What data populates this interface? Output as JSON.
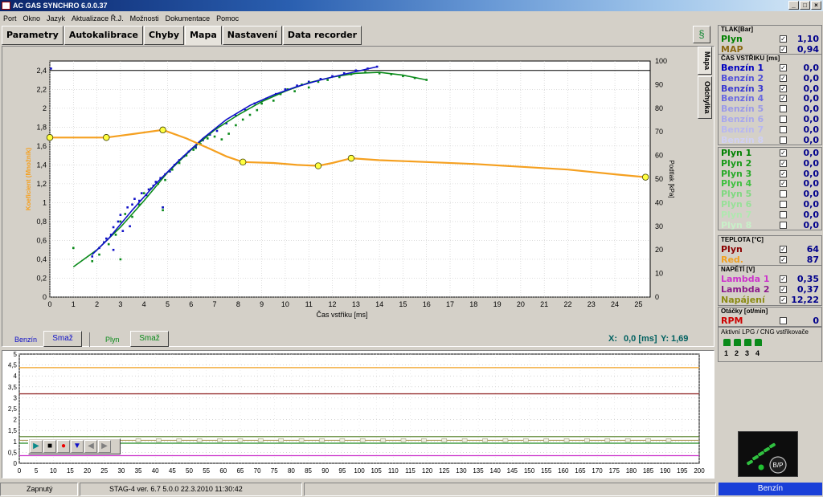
{
  "window": {
    "title": "AC GAS SYNCHRO  6.0.0.37"
  },
  "menu": [
    "Port",
    "Okno",
    "Jazyk",
    "Aktualizace Ř.J.",
    "Možnosti",
    "Dokumentace",
    "Pomoc"
  ],
  "tabs": [
    "Parametry",
    "Autokalibrace",
    "Chyby",
    "Mapa",
    "Nastavení",
    "Data recorder"
  ],
  "active_tab": "Mapa",
  "vertical_tabs": [
    "Mapa",
    "Odchylka"
  ],
  "controls": {
    "benzin_label": "Benzín",
    "benzin_clear": "Smaž",
    "plyn_label": "Plyn",
    "plyn_clear": "Smaž",
    "readout_x_label": "X:",
    "readout_x_value": "0,0 [ms]",
    "readout_y_label": "Y:",
    "readout_y_value": "1,69"
  },
  "chart_data": {
    "type": "scatter",
    "xlabel": "Čas vstřiku [ms]",
    "ylabel_left": "Koeficient (Množník)",
    "ylabel_right": "Podtlak [kPa]",
    "x_ticks": [
      "0",
      "1",
      "2",
      "3",
      "4",
      "5",
      "6",
      "7",
      "8",
      "9",
      "10",
      "11",
      "12",
      "13",
      "14",
      "15",
      "16",
      "17",
      "18",
      "19",
      "20",
      "21",
      "22",
      "23",
      "24",
      "25"
    ],
    "y_left_ticks": [
      "0",
      "0,2",
      "0,4",
      "0,6",
      "0,8",
      "1",
      "1,2",
      "1,4",
      "1,6",
      "1,8",
      "2",
      "2,2",
      "2,4"
    ],
    "y_right_ticks": [
      "0",
      "10",
      "20",
      "30",
      "40",
      "50",
      "60",
      "70",
      "80",
      "90",
      "100"
    ],
    "xlim": [
      0,
      25.5
    ],
    "ylim_left": [
      0,
      2.5
    ],
    "ylim_right": [
      0,
      100
    ],
    "colors": {
      "benzin": "#1010c8",
      "plyn": "#0a8a1a",
      "koef": "#f5a020",
      "koef_marker": "#ffff40"
    },
    "koeficient_points": [
      [
        0,
        1.69
      ],
      [
        2.4,
        1.69
      ],
      [
        4.8,
        1.77
      ],
      [
        8.2,
        1.43
      ],
      [
        11.4,
        1.39
      ],
      [
        12.8,
        1.47
      ],
      [
        25.3,
        1.27
      ]
    ],
    "koeficient_line": [
      [
        0,
        1.69
      ],
      [
        2.4,
        1.69
      ],
      [
        3.6,
        1.73
      ],
      [
        4.8,
        1.77
      ],
      [
        5.8,
        1.68
      ],
      [
        6.8,
        1.57
      ],
      [
        7.5,
        1.49
      ],
      [
        8.2,
        1.43
      ],
      [
        9.5,
        1.42
      ],
      [
        10.5,
        1.4
      ],
      [
        11.4,
        1.39
      ],
      [
        12.0,
        1.42
      ],
      [
        12.8,
        1.47
      ],
      [
        14,
        1.45
      ],
      [
        16,
        1.43
      ],
      [
        18,
        1.41
      ],
      [
        20,
        1.38
      ],
      [
        22,
        1.35
      ],
      [
        24,
        1.3
      ],
      [
        25.3,
        1.27
      ]
    ],
    "benzin_trend": [
      [
        1.8,
        0.45
      ],
      [
        2.5,
        0.62
      ],
      [
        3.5,
        0.92
      ],
      [
        4.5,
        1.2
      ],
      [
        5.5,
        1.45
      ],
      [
        6.5,
        1.68
      ],
      [
        7.5,
        1.88
      ],
      [
        8.5,
        2.03
      ],
      [
        9.5,
        2.14
      ],
      [
        10.5,
        2.23
      ],
      [
        11.5,
        2.3
      ],
      [
        12.5,
        2.36
      ],
      [
        13.9,
        2.44
      ]
    ],
    "plyn_trend": [
      [
        1.0,
        0.32
      ],
      [
        2.0,
        0.5
      ],
      [
        3.0,
        0.74
      ],
      [
        4.0,
        1.02
      ],
      [
        5.0,
        1.32
      ],
      [
        6.0,
        1.56
      ],
      [
        7.0,
        1.77
      ],
      [
        8.0,
        1.93
      ],
      [
        9.0,
        2.07
      ],
      [
        10.0,
        2.18
      ],
      [
        11.0,
        2.27
      ],
      [
        12.0,
        2.33
      ],
      [
        13.0,
        2.37
      ],
      [
        14.0,
        2.38
      ],
      [
        15.0,
        2.35
      ],
      [
        16.0,
        2.3
      ]
    ],
    "benzin_points": [
      [
        0.05,
        2.42
      ],
      [
        1.8,
        0.43
      ],
      [
        2.1,
        0.52
      ],
      [
        2.3,
        0.58
      ],
      [
        2.4,
        0.62
      ],
      [
        2.6,
        0.66
      ],
      [
        2.7,
        0.74
      ],
      [
        2.9,
        0.8
      ],
      [
        3.0,
        0.87
      ],
      [
        3.1,
        0.7
      ],
      [
        3.3,
        0.95
      ],
      [
        3.5,
        0.98
      ],
      [
        3.6,
        1.04
      ],
      [
        3.8,
        1.02
      ],
      [
        3.9,
        1.1
      ],
      [
        4.1,
        1.08
      ],
      [
        4.2,
        1.14
      ],
      [
        4.4,
        1.18
      ],
      [
        4.5,
        1.22
      ],
      [
        4.7,
        1.26
      ],
      [
        4.9,
        1.3
      ],
      [
        5.1,
        1.33
      ],
      [
        5.3,
        1.4
      ],
      [
        5.5,
        1.45
      ],
      [
        5.7,
        1.49
      ],
      [
        5.9,
        1.54
      ],
      [
        6.2,
        1.59
      ],
      [
        6.5,
        1.66
      ],
      [
        6.8,
        1.72
      ],
      [
        7.1,
        1.76
      ],
      [
        7.5,
        1.84
      ],
      [
        7.9,
        1.92
      ],
      [
        8.3,
        1.98
      ],
      [
        8.7,
        2.05
      ],
      [
        9.2,
        2.1
      ],
      [
        9.6,
        2.15
      ],
      [
        10.0,
        2.2
      ],
      [
        10.5,
        2.24
      ],
      [
        11.0,
        2.28
      ],
      [
        11.5,
        2.31
      ],
      [
        12.0,
        2.34
      ],
      [
        12.5,
        2.37
      ],
      [
        13.0,
        2.4
      ],
      [
        13.5,
        2.42
      ],
      [
        13.9,
        2.44
      ],
      [
        2.7,
        0.5
      ],
      [
        3.4,
        0.75
      ],
      [
        4.8,
        0.95
      ]
    ],
    "plyn_points": [
      [
        1.0,
        0.52
      ],
      [
        1.8,
        0.38
      ],
      [
        2.1,
        0.45
      ],
      [
        2.5,
        0.56
      ],
      [
        2.8,
        0.66
      ],
      [
        3.0,
        0.8
      ],
      [
        3.2,
        0.88
      ],
      [
        3.5,
        0.85
      ],
      [
        3.8,
        0.98
      ],
      [
        4.0,
        1.1
      ],
      [
        4.3,
        1.15
      ],
      [
        4.6,
        1.2
      ],
      [
        4.9,
        1.24
      ],
      [
        5.2,
        1.35
      ],
      [
        5.5,
        1.42
      ],
      [
        5.8,
        1.5
      ],
      [
        6.1,
        1.56
      ],
      [
        6.4,
        1.62
      ],
      [
        6.7,
        1.68
      ],
      [
        7.0,
        1.7
      ],
      [
        7.3,
        1.67
      ],
      [
        7.6,
        1.73
      ],
      [
        7.9,
        1.82
      ],
      [
        8.2,
        1.88
      ],
      [
        8.5,
        1.93
      ],
      [
        8.8,
        1.98
      ],
      [
        9.0,
        2.05
      ],
      [
        9.2,
        2.1
      ],
      [
        9.5,
        2.08
      ],
      [
        9.8,
        2.15
      ],
      [
        10.1,
        2.2
      ],
      [
        10.4,
        2.18
      ],
      [
        10.7,
        2.25
      ],
      [
        11.0,
        2.22
      ],
      [
        11.4,
        2.28
      ],
      [
        11.8,
        2.3
      ],
      [
        12.3,
        2.33
      ],
      [
        12.8,
        2.36
      ],
      [
        13.4,
        2.38
      ],
      [
        14.0,
        2.37
      ],
      [
        14.5,
        2.36
      ],
      [
        15.0,
        2.34
      ],
      [
        15.5,
        2.32
      ],
      [
        16.0,
        2.3
      ],
      [
        3.0,
        0.4
      ],
      [
        4.8,
        0.95
      ],
      [
        4.8,
        0.92
      ],
      [
        6.2,
        1.58
      ]
    ]
  },
  "logger": {
    "y_ticks": [
      "0",
      "0,5",
      "1",
      "1,5",
      "2",
      "2,5",
      "3",
      "3,5",
      "4",
      "4,5",
      "5"
    ],
    "x_ticks": [
      "0",
      "5",
      "10",
      "15",
      "20",
      "25",
      "30",
      "35",
      "40",
      "45",
      "50",
      "55",
      "60",
      "65",
      "70",
      "75",
      "80",
      "85",
      "90",
      "95",
      "100",
      "105",
      "110",
      "115",
      "120",
      "125",
      "130",
      "135",
      "140",
      "145",
      "150",
      "155",
      "160",
      "165",
      "170",
      "175",
      "180",
      "185",
      "190",
      "195",
      "200"
    ],
    "ylim": [
      0,
      5
    ],
    "xlim": [
      0,
      200
    ],
    "lines": [
      {
        "color": "#f0a020",
        "value": 4.38
      },
      {
        "color": "#8b1a1a",
        "value": 3.18
      },
      {
        "color": "#4a7a1a",
        "value": 1.22
      },
      {
        "color": "#b0a060",
        "value": 1.05
      },
      {
        "color": "#228b22",
        "value": 0.92
      },
      {
        "color": "#cc33cc",
        "value": 0.35
      }
    ],
    "player_buttons": [
      "play",
      "stop",
      "record",
      "speed-down",
      "prev",
      "next"
    ]
  },
  "right_panel": {
    "tlak": {
      "header": "TLAK[Bar]",
      "rows": [
        {
          "label": "Plyn",
          "color": "#008000",
          "checked": true,
          "value": "1,10"
        },
        {
          "label": "MAP",
          "color": "#8b6914",
          "checked": true,
          "value": "0,94"
        }
      ]
    },
    "cas_vstriku": {
      "header": "ČAS VSTŘIKU  [ms]",
      "rows": [
        {
          "label": "Benzín 1",
          "color": "#0000c0",
          "checked": true,
          "value": "0,0"
        },
        {
          "label": "Benzín 2",
          "color": "#5050d8",
          "checked": true,
          "value": "0,0"
        },
        {
          "label": "Benzín 3",
          "color": "#3a3ad0",
          "checked": true,
          "value": "0,0"
        },
        {
          "label": "Benzín 4",
          "color": "#6a6ae0",
          "checked": true,
          "value": "0,0"
        },
        {
          "label": "Benzín 5",
          "color": "#9a9ae8",
          "checked": false,
          "value": "0,0"
        },
        {
          "label": "Benzín 6",
          "color": "#a8a8ec",
          "checked": false,
          "value": "0,0"
        },
        {
          "label": "Benzín 7",
          "color": "#b8b8f0",
          "checked": false,
          "value": "0,0"
        },
        {
          "label": "Benzín 8",
          "color": "#d0d0f4",
          "checked": false,
          "value": "0,0"
        }
      ]
    },
    "plyn": {
      "rows": [
        {
          "label": "Plyn 1",
          "color": "#008000",
          "checked": true,
          "value": "0,0"
        },
        {
          "label": "Plyn 2",
          "color": "#1a9a1a",
          "checked": true,
          "value": "0,0"
        },
        {
          "label": "Plyn 3",
          "color": "#2aaa2a",
          "checked": true,
          "value": "0,0"
        },
        {
          "label": "Plyn 4",
          "color": "#40c040",
          "checked": true,
          "value": "0,0"
        },
        {
          "label": "Plyn 5",
          "color": "#80d880",
          "checked": false,
          "value": "0,0"
        },
        {
          "label": "Plyn 6",
          "color": "#98e098",
          "checked": false,
          "value": "0,0"
        },
        {
          "label": "Plyn 7",
          "color": "#b0e8b0",
          "checked": false,
          "value": "0,0"
        },
        {
          "label": "Plyn 8",
          "color": "#c8f0c8",
          "checked": false,
          "value": "0,0"
        }
      ]
    },
    "teplota": {
      "header": "TEPLOTA  [°C]",
      "rows": [
        {
          "label": "Plyn",
          "color": "#8b0000",
          "checked": true,
          "value": "64"
        },
        {
          "label": "Red.",
          "color": "#f0a020",
          "checked": true,
          "value": "87"
        }
      ]
    },
    "napeti": {
      "header": "NAPĚTÍ [V]",
      "rows": [
        {
          "label": "Lambda 1",
          "color": "#cc33cc",
          "checked": true,
          "value": "0,35"
        },
        {
          "label": "Lambda 2",
          "color": "#8b1a8b",
          "checked": true,
          "value": "0,37"
        },
        {
          "label": "Napájení",
          "color": "#8b8b14",
          "checked": true,
          "value": "12,22"
        }
      ]
    },
    "otacky": {
      "header": "Otáčky [ot/min]",
      "rows": [
        {
          "label": "RPM",
          "color": "#cc0000",
          "checked": false,
          "value": "0"
        }
      ]
    },
    "injectors": {
      "label": "Aktivní LPG / CNG vstřikovače",
      "numbers": [
        "1",
        "2",
        "3",
        "4"
      ]
    },
    "logo": {
      "text": "B/P"
    },
    "fuel_indicator": "Benzín"
  },
  "status": {
    "left": "Zapnutý",
    "middle": "STAG-4   ver. 6.7  5.0.0    22.3.2010 11:30:42"
  }
}
